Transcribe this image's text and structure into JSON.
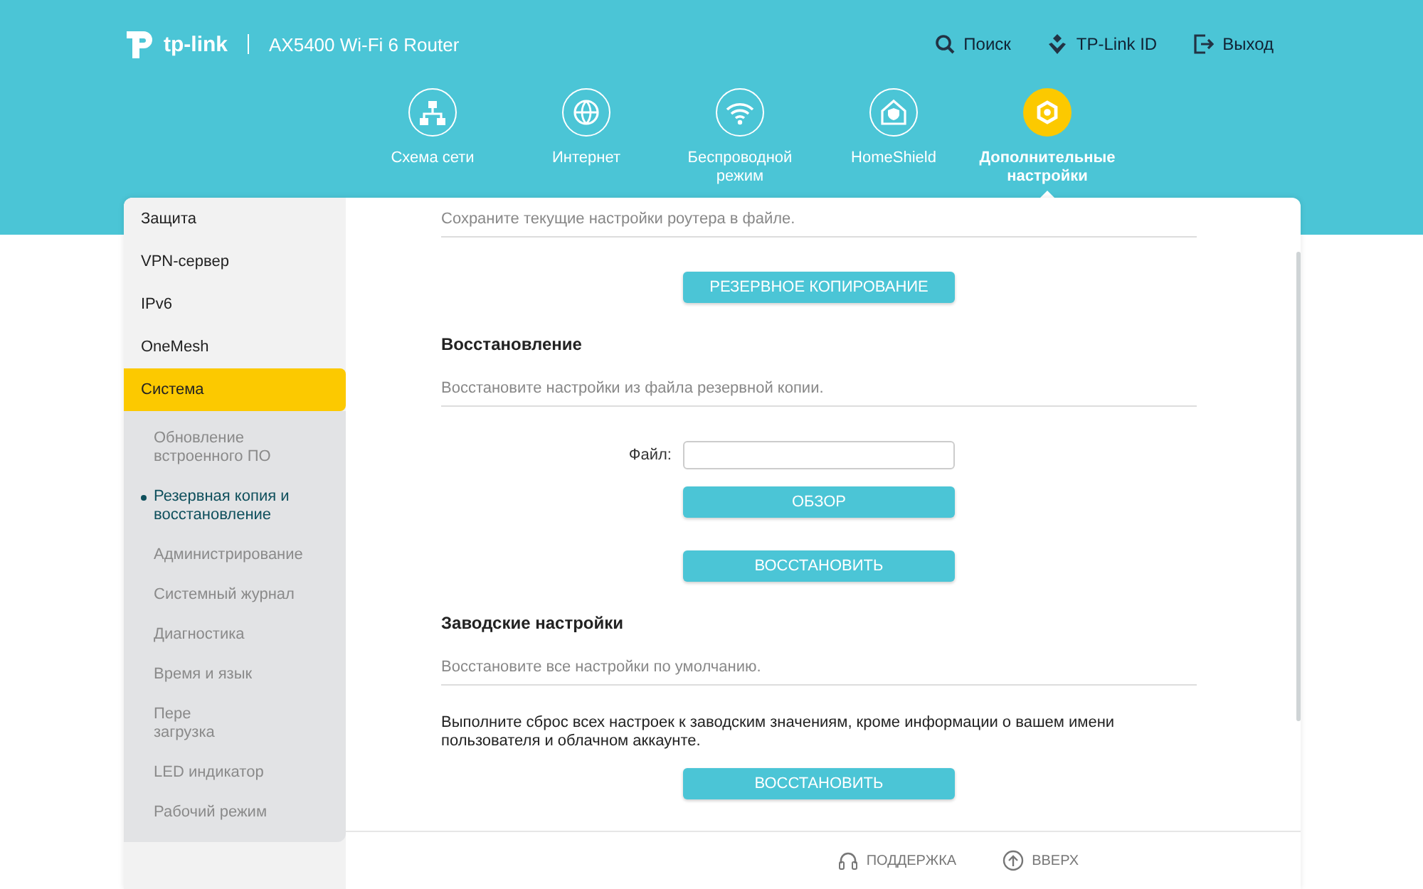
{
  "header": {
    "brand": "tp-link",
    "model": "AX5400 Wi-Fi 6 Router",
    "links": [
      {
        "kind": "search",
        "label": "Поиск"
      },
      {
        "kind": "id",
        "label": "TP-Link ID"
      },
      {
        "kind": "logout",
        "label": "Выход"
      }
    ]
  },
  "nav": [
    {
      "kind": "network",
      "label": "Схема сети",
      "selected": false
    },
    {
      "kind": "internet",
      "label": "Интернет",
      "selected": false
    },
    {
      "kind": "wireless",
      "label": "Беспроводной режим",
      "selected": false
    },
    {
      "kind": "homeshield",
      "label": "HomeShield",
      "selected": false
    },
    {
      "kind": "advanced",
      "label": "Дополнительные настройки",
      "selected": true
    }
  ],
  "sidebar": {
    "items": [
      {
        "label": "Защита",
        "selected": false
      },
      {
        "label": "VPN-сервер",
        "selected": false
      },
      {
        "label": "IPv6",
        "selected": false
      },
      {
        "label": "OneMesh",
        "selected": false
      },
      {
        "label": "Система",
        "selected": true,
        "children": [
          {
            "label": "Обновление встроенного ПО",
            "selected": false
          },
          {
            "label": "Резервная копия и восстановление",
            "selected": true
          },
          {
            "label": "Администрирование",
            "selected": false
          },
          {
            "label": "Системный журнал",
            "selected": false
          },
          {
            "label": "Диагностика",
            "selected": false
          },
          {
            "label": "Время и язык",
            "selected": false
          },
          {
            "label": "Пере\nзагрузка",
            "selected": false
          },
          {
            "label": "LED индикатор",
            "selected": false
          },
          {
            "label": "Рабочий режим",
            "selected": false
          }
        ]
      }
    ]
  },
  "sections": [
    {
      "description": "Сохраните текущие настройки роутера в файле.",
      "controls": [
        {
          "kind": "button",
          "label": "РЕЗЕРВНОЕ КОПИРОВАНИЕ"
        }
      ]
    },
    {
      "title": "Восстановление",
      "description": "Восстановите настройки из файла резервной копии.",
      "controls": [
        {
          "kind": "file",
          "label": "Файл:"
        },
        {
          "kind": "button",
          "label": "ОБЗОР"
        },
        {
          "kind": "button",
          "label": "ВОССТАНОВИТЬ"
        }
      ]
    },
    {
      "title": "Заводские настройки",
      "description": "Восстановите все настройки по умолчанию.",
      "controls": [
        {
          "kind": "paragraph",
          "label": "Выполните сброс всех настроек к заводским значениям, кроме информации о вашем имени пользователя и облачном аккаунте."
        },
        {
          "kind": "button",
          "label": "ВОССТАНОВИТЬ"
        }
      ]
    }
  ],
  "footer": [
    {
      "kind": "support",
      "label": "ПОДДЕРЖКА"
    },
    {
      "kind": "top",
      "label": "ВВЕРХ"
    }
  ]
}
